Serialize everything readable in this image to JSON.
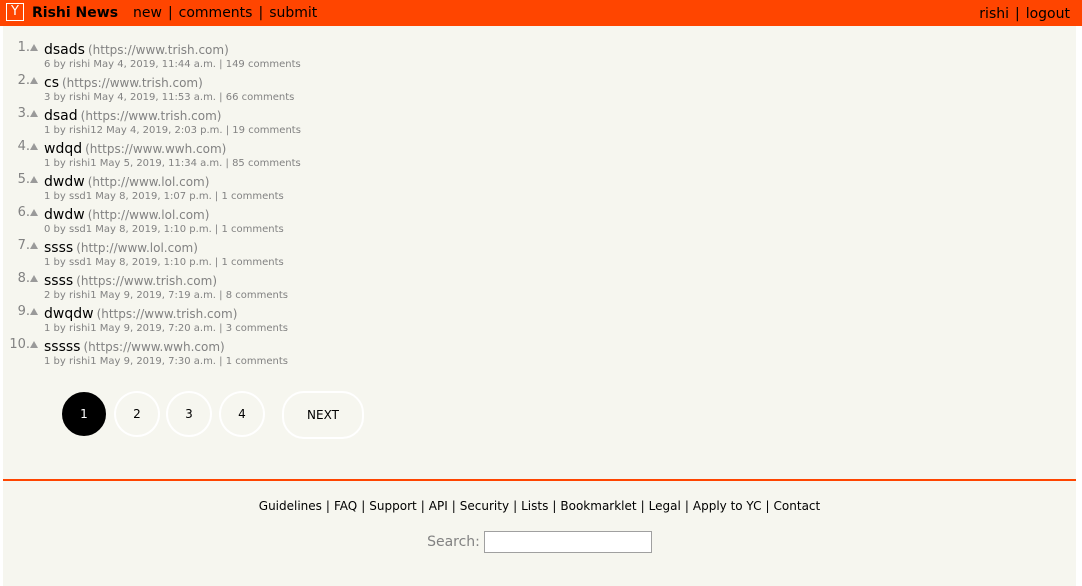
{
  "header": {
    "logo": "Y",
    "site_name": "Rishi News",
    "nav": [
      "new",
      "comments",
      "submit"
    ],
    "user": "rishi",
    "logout": "logout"
  },
  "stories": [
    {
      "rank": "1.",
      "title": "dsads",
      "domain": "(https://www.trish.com)",
      "meta": "6 by rishi May 4, 2019, 11:44 a.m. | 149 comments"
    },
    {
      "rank": "2.",
      "title": "cs",
      "domain": "(https://www.trish.com)",
      "meta": "3 by rishi May 4, 2019, 11:53 a.m. | 66 comments"
    },
    {
      "rank": "3.",
      "title": "dsad",
      "domain": "(https://www.trish.com)",
      "meta": "1 by rishi12 May 4, 2019, 2:03 p.m. | 19 comments"
    },
    {
      "rank": "4.",
      "title": "wdqd",
      "domain": "(https://www.wwh.com)",
      "meta": "1 by rishi1 May 5, 2019, 11:34 a.m. | 85 comments"
    },
    {
      "rank": "5.",
      "title": "dwdw",
      "domain": "(http://www.lol.com)",
      "meta": "1 by ssd1 May 8, 2019, 1:07 p.m. | 1 comments"
    },
    {
      "rank": "6.",
      "title": "dwdw",
      "domain": "(http://www.lol.com)",
      "meta": "0 by ssd1 May 8, 2019, 1:10 p.m. | 1 comments"
    },
    {
      "rank": "7.",
      "title": "ssss",
      "domain": "(http://www.lol.com)",
      "meta": "1 by ssd1 May 8, 2019, 1:10 p.m. | 1 comments"
    },
    {
      "rank": "8.",
      "title": "ssss",
      "domain": "(https://www.trish.com)",
      "meta": "2 by rishi1 May 9, 2019, 7:19 a.m. | 8 comments"
    },
    {
      "rank": "9.",
      "title": "dwqdw",
      "domain": "(https://www.trish.com)",
      "meta": "1 by rishi1 May 9, 2019, 7:20 a.m. | 3 comments"
    },
    {
      "rank": "10.",
      "title": "sssss",
      "domain": "(https://www.wwh.com)",
      "meta": "1 by rishi1 May 9, 2019, 7:30 a.m. | 1 comments"
    }
  ],
  "pagination": {
    "pages": [
      "1",
      "2",
      "3",
      "4"
    ],
    "current": "1",
    "next": "NEXT"
  },
  "footer": {
    "links": [
      "Guidelines",
      "FAQ",
      "Support",
      "API",
      "Security",
      "Lists",
      "Bookmarklet",
      "Legal",
      "Apply to YC",
      "Contact"
    ],
    "search_label": "Search:",
    "search_value": ""
  },
  "colors": {
    "brand": "#ff4500",
    "background": "#f6f6ef",
    "subtext": "#828282"
  }
}
